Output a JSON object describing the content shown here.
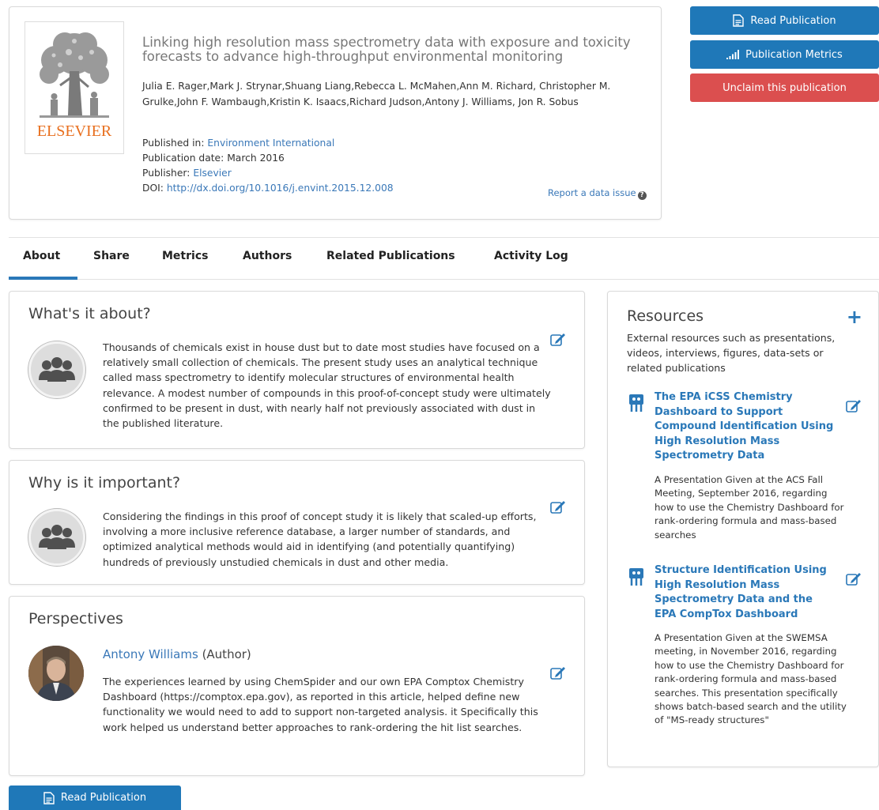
{
  "publication": {
    "cover_logo": "ELSEVIER",
    "title": "Linking high resolution mass spectrometry data with exposure and toxicity forecasts to advance high-throughput environmental monitoring",
    "authors": "Julia E. Rager,Mark J. Strynar,Shuang Liang,Rebecca L. McMahen,Ann M. Richard, Christopher M. Grulke,John F. Wambaugh,Kristin K. Isaacs,Richard Judson,Antony J. Williams, Jon R. Sobus",
    "published_in_label": "Published in:",
    "published_in": "Environment International",
    "date_label": "Publication date:",
    "date": "March 2016",
    "publisher_label": "Publisher:",
    "publisher": "Elsevier",
    "doi_label": "DOI:",
    "doi": "http://dx.doi.org/10.1016/j.envint.2015.12.008",
    "report_issue": "Report a data issue"
  },
  "actions": {
    "read": "Read Publication",
    "metrics": "Publication Metrics",
    "unclaim": "Unclaim this publication"
  },
  "tabs": [
    "About",
    "Share",
    "Metrics",
    "Authors",
    "Related Publications",
    "Activity Log"
  ],
  "about": {
    "title": "What's it about?",
    "text": "Thousands of chemicals exist in house dust but to date most studies have focused on a relatively small collection of chemicals. The present study uses an analytical technique called mass spectrometry to identify molecular structures of environmental health relevance. A modest number of compounds in this proof-of-concept study were ultimately confirmed to be present in dust, with nearly half not previously associated with dust in the published literature."
  },
  "important": {
    "title": "Why is it important?",
    "text": "Considering the findings in this proof of concept study it is likely that scaled-up efforts, involving a more inclusive reference database, a larger number of standards, and optimized analytical methods would aid in identifying (and potentially quantifying) hundreds of previously unstudied chemicals in dust and other media."
  },
  "perspectives": {
    "title": "Perspectives",
    "author_name": "Antony Williams",
    "author_role": "(Author)",
    "text": "The experiences learned by using ChemSpider and our own EPA Comptox Chemistry Dashboard (https://comptox.epa.gov), as reported in this article, helped define new functionality we would need to add to support non-targeted analysis. it Specifically this work helped us understand better approaches to rank-ordering the hit list searches."
  },
  "resources": {
    "title": "Resources",
    "subtitle": "External resources such as presentations, videos, interviews, figures, data-sets or related publications",
    "items": [
      {
        "title": "The EPA iCSS Chemistry Dashboard to Support Compound Identification Using High Resolution Mass Spectrometry Data",
        "description": "A Presentation Given at the ACS Fall Meeting, September 2016, regarding how to use the Chemistry Dashboard for rank-ordering formula and mass-based searches"
      },
      {
        "title": "Structure Identification Using High Resolution Mass Spectrometry Data and the EPA CompTox Dashboard",
        "description": "A Presentation Given at the SWEMSA meeting, in November 2016, regarding how to use the Chemistry Dashboard for rank-ordering formula and mass-based searches. This presentation specifically shows batch-based search and the utility of \"MS-ready structures\""
      }
    ]
  },
  "footer": {
    "read": "Read Publication"
  }
}
